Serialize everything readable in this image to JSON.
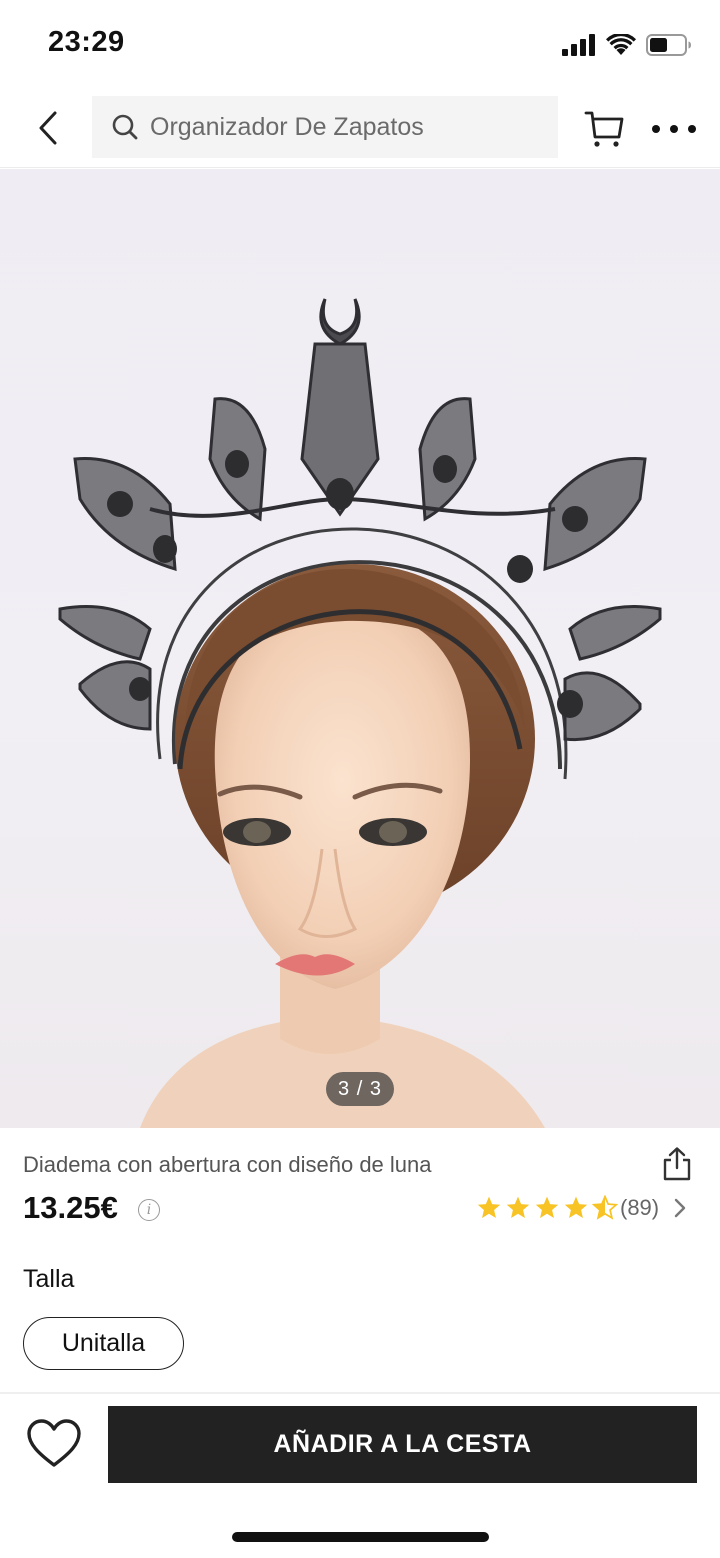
{
  "status_bar": {
    "time": "23:29"
  },
  "nav": {
    "search_placeholder": "Organizador De Zapatos"
  },
  "gallery": {
    "counter": "3 / 3"
  },
  "product": {
    "title": "Diadema con abertura con diseño de luna",
    "price": "13.25€",
    "rating": 4.5,
    "review_count": "(89)"
  },
  "size": {
    "label": "Talla",
    "selected": "Unitalla"
  },
  "actions": {
    "add_to_cart": "AÑADIR A LA CESTA"
  },
  "colors": {
    "star": "#f7c325",
    "button_bg": "#222222",
    "accent_text": "#111111"
  },
  "icons": [
    "back-chevron-icon",
    "search-icon",
    "cart-icon",
    "more-icon",
    "share-icon",
    "info-icon",
    "star-icon",
    "chevron-right-icon",
    "heart-icon"
  ]
}
